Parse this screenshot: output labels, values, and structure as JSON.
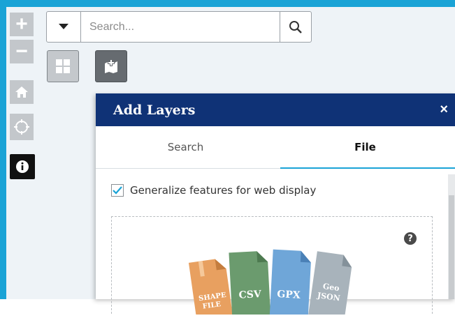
{
  "search": {
    "placeholder": "Search..."
  },
  "panel": {
    "title": "Add Layers",
    "close": "×",
    "tabs": [
      {
        "label": "Search"
      },
      {
        "label": "File",
        "active": true
      }
    ],
    "generalize": {
      "label": "Generalize features for web display",
      "checked": true
    },
    "help": "?",
    "file_types": [
      {
        "line1": "SHAPE",
        "line2": "FILE",
        "color": "#e8a060"
      },
      {
        "line1": "CSV",
        "line2": "",
        "color": "#6b9b6e"
      },
      {
        "line1": "GPX",
        "line2": "",
        "color": "#6fa6d8"
      },
      {
        "line1": "Geo",
        "line2": "JSON",
        "color": "#a8b3bb"
      }
    ]
  },
  "colors": {
    "accent": "#1aa3d6",
    "header": "#0f3276"
  },
  "icons": {
    "zoom_in": "plus-icon",
    "zoom_out": "minus-icon",
    "home": "home-icon",
    "locate": "locate-icon",
    "info": "info-icon",
    "dropdown": "caret-down-icon",
    "search": "search-icon",
    "basemap": "grid-icon",
    "add_layer": "add-layer-icon"
  }
}
